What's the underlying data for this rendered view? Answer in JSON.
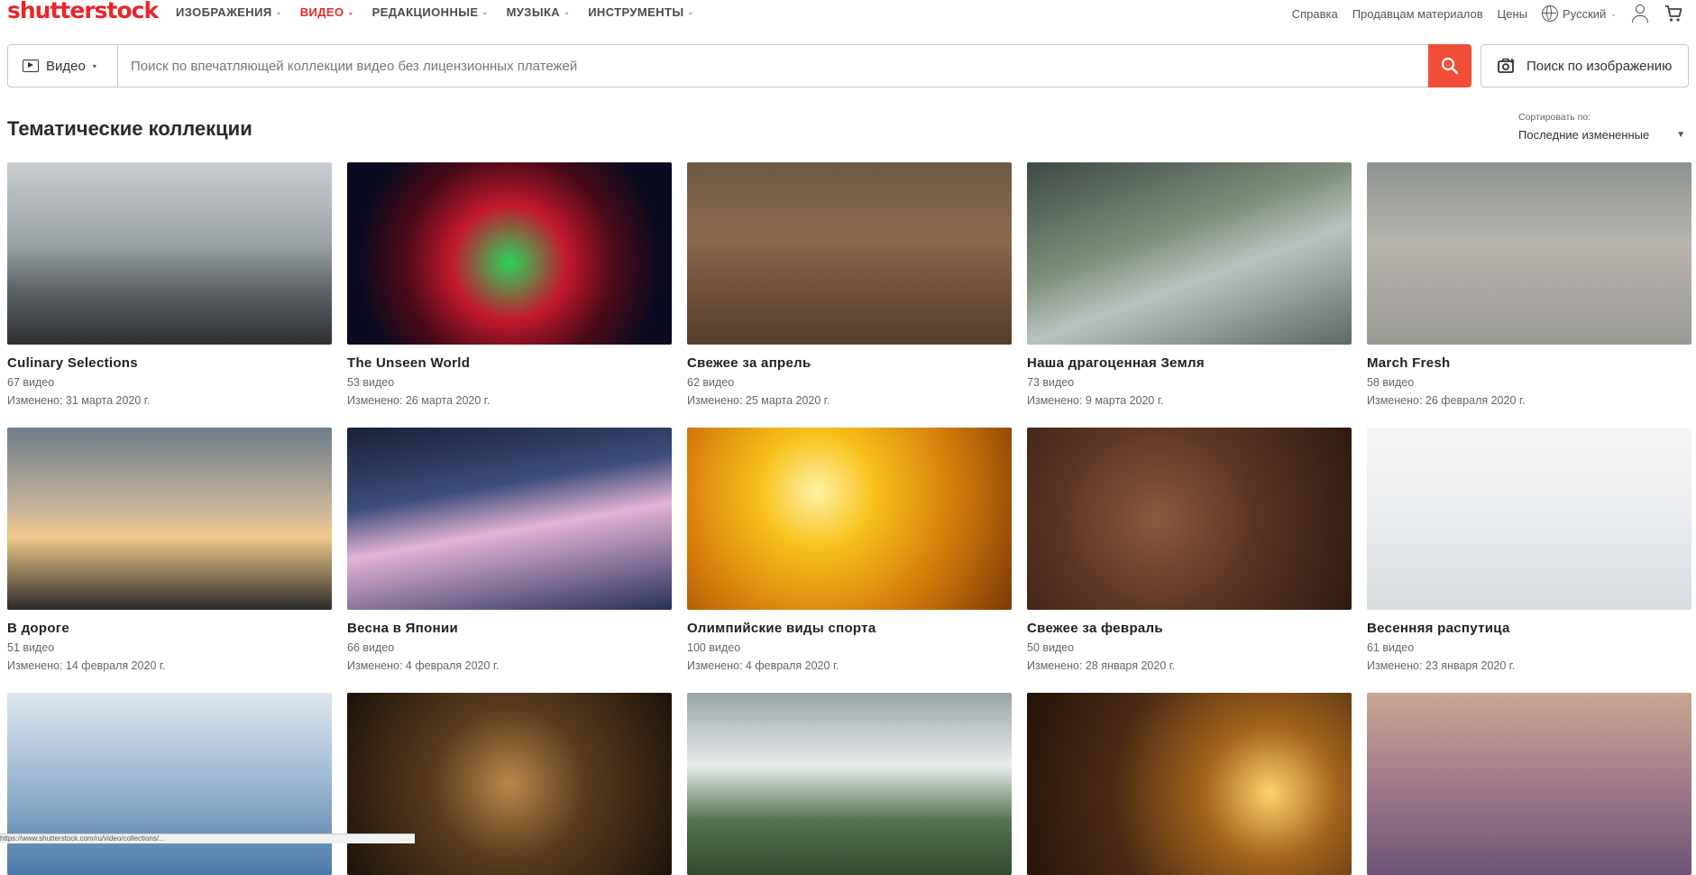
{
  "brand": {
    "logo_text": "shutterstock"
  },
  "nav": {
    "items": [
      {
        "label": "ИЗОБРАЖЕНИЯ",
        "active": false
      },
      {
        "label": "ВИДЕО",
        "active": true
      },
      {
        "label": "РЕДАКЦИОННЫЕ",
        "active": false
      },
      {
        "label": "МУЗЫКА",
        "active": false
      },
      {
        "label": "ИНСТРУМЕНТЫ",
        "active": false
      }
    ],
    "help": "Справка",
    "sellers": "Продавцам материалов",
    "pricing": "Цены",
    "language": "Русский"
  },
  "search": {
    "type": "Видео",
    "placeholder": "Поиск по впечатляющей коллекции видео без лицензионных платежей",
    "image_search": "Поиск по изображению"
  },
  "page": {
    "title": "Тематические коллекции",
    "sort_label": "Сортировать по:",
    "sort_value": "Последние измененные"
  },
  "collections": [
    {
      "title": "Culinary Selections",
      "count": "67 видео",
      "modified": "Изменено: 31 марта 2020 г."
    },
    {
      "title": "The Unseen World",
      "count": "53 видео",
      "modified": "Изменено: 26 марта 2020 г."
    },
    {
      "title": "Свежее за апрель",
      "count": "62 видео",
      "modified": "Изменено: 25 марта 2020 г."
    },
    {
      "title": "Наша драгоценная Земля",
      "count": "73 видео",
      "modified": "Изменено: 9 марта 2020 г."
    },
    {
      "title": "March Fresh",
      "count": "58 видео",
      "modified": "Изменено: 26 февраля 2020 г."
    },
    {
      "title": "В дороге",
      "count": "51 видео",
      "modified": "Изменено: 14 февраля 2020 г."
    },
    {
      "title": "Весна в Японии",
      "count": "66 видео",
      "modified": "Изменено: 4 февраля 2020 г."
    },
    {
      "title": "Олимпийские виды спорта",
      "count": "100 видео",
      "modified": "Изменено: 4 февраля 2020 г."
    },
    {
      "title": "Свежее за февраль",
      "count": "50 видео",
      "modified": "Изменено: 28 января 2020 г."
    },
    {
      "title": "Весенняя распутица",
      "count": "61 видео",
      "modified": "Изменено: 23 января 2020 г."
    },
    {
      "title": "",
      "count": "",
      "modified": ""
    },
    {
      "title": "",
      "count": "",
      "modified": ""
    },
    {
      "title": "",
      "count": "",
      "modified": ""
    },
    {
      "title": "",
      "count": "",
      "modified": ""
    },
    {
      "title": "",
      "count": "",
      "modified": ""
    }
  ],
  "thumb_styles": [
    "linear-gradient(180deg,#c9cdd0 0%,#9aa2a6 45%,#5d6367 70%,#2e3134 100%)",
    "radial-gradient(circle at 50% 55%,#2bd45a 0%,#c2192c 30%,#4b0a18 55%,#0a0b20 80%)",
    "linear-gradient(180deg,#6e5a43 0%,#8a6a4d 40%,#6b4e36 75%,#553d2b 100%)",
    "linear-gradient(160deg,#3d4a45 0%,#7d8e7a 40%,#b9c4bf 60%,#5b6866 100%)",
    "linear-gradient(180deg,#8c938e 0%,#b7b5ae 45%,#9a9892 100%)",
    "linear-gradient(180deg,#6f7d8c 0%,#c9b59a 45%,#f0c98a 60%,#2b2a2a 100%)",
    "linear-gradient(170deg,#1a2036 0%,#3c4d7a 35%,#e5b2d6 55%,#27315a 100%)",
    "radial-gradient(circle at 40% 35%,#fff2a6 0%,#f7c21c 25%,#d67c0b 60%,#7a3a05 100%)",
    "radial-gradient(circle at 40% 50%,#8a5a3d 0%,#5b3523 45%,#2e1a11 100%)",
    "linear-gradient(180deg,#f5f5f5 0%,#e9ecef 50%,#d8dde0 100%)",
    "linear-gradient(180deg,#dfe7ee 0%,#9ab7d0 50%,#4a79a8 100%)",
    "radial-gradient(circle at 50% 50%,#b8894a 0%,#5a3c1d 40%,#1c1209 100%)",
    "linear-gradient(180deg,#9aa5a6 0%,#e7ecec 40%,#567450 70%,#2f4a2c 100%)",
    "radial-gradient(circle at 75% 55%,#ffd36b 0%,#a3651c 25%,#4a2a14 60%,#241308 100%)",
    "linear-gradient(180deg,#c9a792 0%,#a07a8b 50%,#6c5575 100%)"
  ],
  "status_text": "https://www.shutterstock.com/ru/video/collections/..."
}
